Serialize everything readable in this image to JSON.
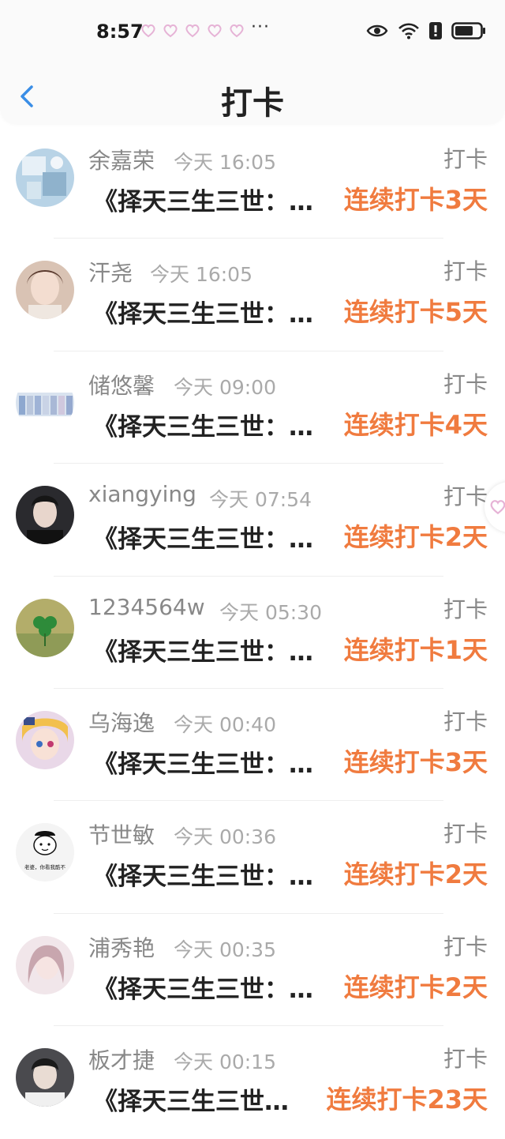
{
  "status_bar": {
    "time": "8:57",
    "more": "···"
  },
  "nav": {
    "title": "打卡"
  },
  "colors": {
    "accent": "#f07b3f",
    "back": "#3a8ee6"
  },
  "items": [
    {
      "name": "余嘉荣",
      "time": "今天 16:05",
      "tag": "打卡",
      "book": "《择天三生三世：…",
      "streak": "连续打卡3天"
    },
    {
      "name": "汗尧",
      "time": "今天 16:05",
      "tag": "打卡",
      "book": "《择天三生三世：…",
      "streak": "连续打卡5天"
    },
    {
      "name": "储悠馨",
      "time": "今天 09:00",
      "tag": "打卡",
      "book": "《择天三生三世：…",
      "streak": "连续打卡4天"
    },
    {
      "name": "xiangying",
      "time": "今天 07:54",
      "tag": "打卡",
      "book": "《择天三生三世：…",
      "streak": "连续打卡2天"
    },
    {
      "name": "1234564w",
      "time": "今天 05:30",
      "tag": "打卡",
      "book": "《择天三生三世：…",
      "streak": "连续打卡1天"
    },
    {
      "name": "乌海逸",
      "time": "今天 00:40",
      "tag": "打卡",
      "book": "《择天三生三世：…",
      "streak": "连续打卡3天"
    },
    {
      "name": "节世敏",
      "time": "今天 00:36",
      "tag": "打卡",
      "book": "《择天三生三世：…",
      "streak": "连续打卡2天"
    },
    {
      "name": "浦秀艳",
      "time": "今天 00:35",
      "tag": "打卡",
      "book": "《择天三生三世：…",
      "streak": "连续打卡2天"
    },
    {
      "name": "板才捷",
      "time": "今天 00:15",
      "tag": "打卡",
      "book": "《择天三生三世…",
      "streak": "连续打卡23天"
    }
  ],
  "avatar_7_caption": "老婆，你看我酷不"
}
